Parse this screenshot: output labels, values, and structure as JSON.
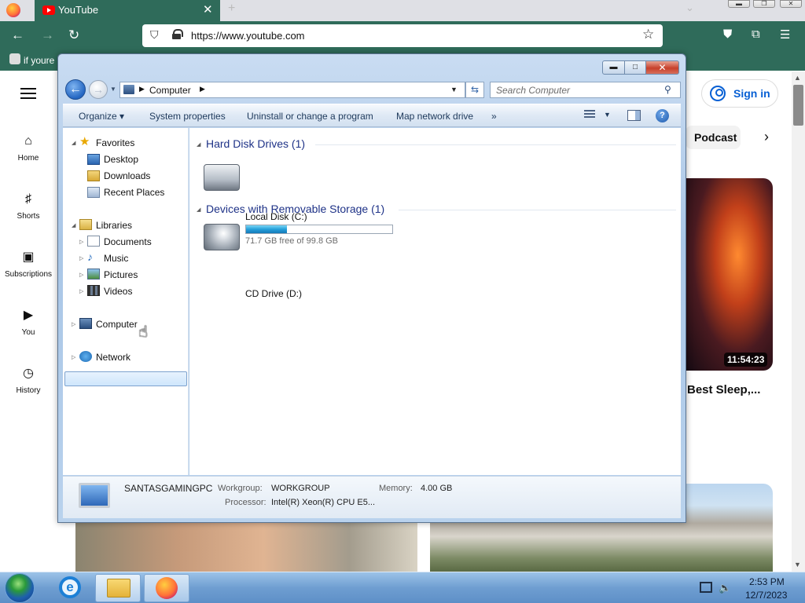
{
  "browser": {
    "tab_title": "YouTube",
    "url": "https://www.youtube.com",
    "bookmark_text": "if youre"
  },
  "youtube": {
    "sidebar": [
      {
        "label": "Home",
        "icon": "home-icon"
      },
      {
        "label": "Shorts",
        "icon": "shorts-icon"
      },
      {
        "label": "Subscriptions",
        "icon": "subscriptions-icon"
      },
      {
        "label": "You",
        "icon": "you-icon"
      },
      {
        "label": "History",
        "icon": "history-icon"
      }
    ],
    "sign_in": "Sign in",
    "chip": "Podcast",
    "video": {
      "duration": "11:54:23",
      "title": "Best Sleep,..."
    }
  },
  "explorer": {
    "breadcrumb": "Computer",
    "search_placeholder": "Search Computer",
    "commands": [
      "Organize",
      "System properties",
      "Uninstall or change a program",
      "Map network drive",
      "»"
    ],
    "nav": {
      "favorites": "Favorites",
      "fav_items": [
        "Desktop",
        "Downloads",
        "Recent Places"
      ],
      "libraries": "Libraries",
      "lib_items": [
        "Documents",
        "Music",
        "Pictures",
        "Videos"
      ],
      "computer": "Computer",
      "network": "Network"
    },
    "groups": {
      "hdd": "Hard Disk Drives (1)",
      "removable": "Devices with Removable Storage (1)"
    },
    "drives": {
      "c_name": "Local Disk (C:)",
      "c_free": "71.7 GB free of 99.8 GB",
      "c_used_fraction": 0.28,
      "d_name": "CD Drive (D:)"
    },
    "details": {
      "pc_name": "SANTASGAMINGPC",
      "workgroup_label": "Workgroup:",
      "workgroup": "WORKGROUP",
      "memory_label": "Memory:",
      "memory": "4.00 GB",
      "processor_label": "Processor:",
      "processor": "Intel(R) Xeon(R) CPU E5..."
    }
  },
  "taskbar": {
    "time": "2:53 PM",
    "date": "12/7/2023"
  }
}
